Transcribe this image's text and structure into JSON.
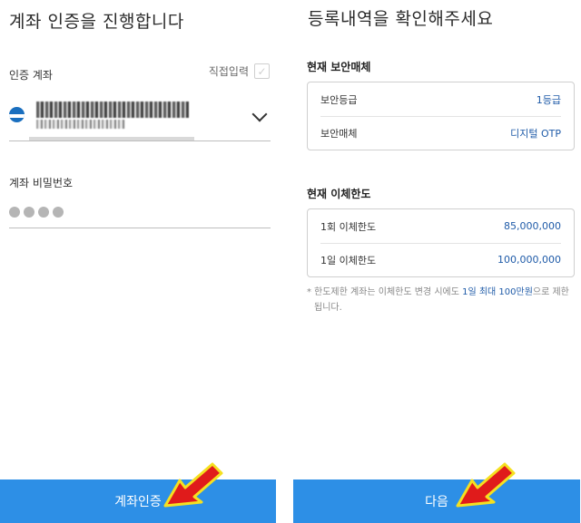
{
  "left": {
    "title": "계좌 인증을 진행합니다",
    "account_label": "인증 계좌",
    "direct_input_label": "직접입력",
    "password_label": "계좌 비밀번호",
    "password_mask_count": 4,
    "button_label": "계좌인증"
  },
  "right": {
    "title": "등록내역을 확인해주세요",
    "security": {
      "section_title": "현재 보안매체",
      "rows": [
        {
          "label": "보안등급",
          "value": "1등급"
        },
        {
          "label": "보안매체",
          "value": "디지털 OTP"
        }
      ]
    },
    "limit": {
      "section_title": "현재 이체한도",
      "rows": [
        {
          "label": "1회 이체한도",
          "value": "85,000,000"
        },
        {
          "label": "1일 이체한도",
          "value": "100,000,000"
        }
      ]
    },
    "notice": {
      "bullet": "*",
      "prefix": "한도제한 계좌는 이체한도 변경 시에도 ",
      "highlight": "1일 최대 100만원",
      "suffix": "으로 제한됩니다."
    },
    "button_label": "다음"
  },
  "colors": {
    "primary_button": "#2d8fe6",
    "value_blue": "#1f5ba8",
    "arrow_red": "#e01b1b",
    "arrow_outline": "#f5e020"
  },
  "icons": [
    "bank-logo-icon",
    "checkbox-icon",
    "chevron-down-icon",
    "arrow-pointer-icon"
  ]
}
